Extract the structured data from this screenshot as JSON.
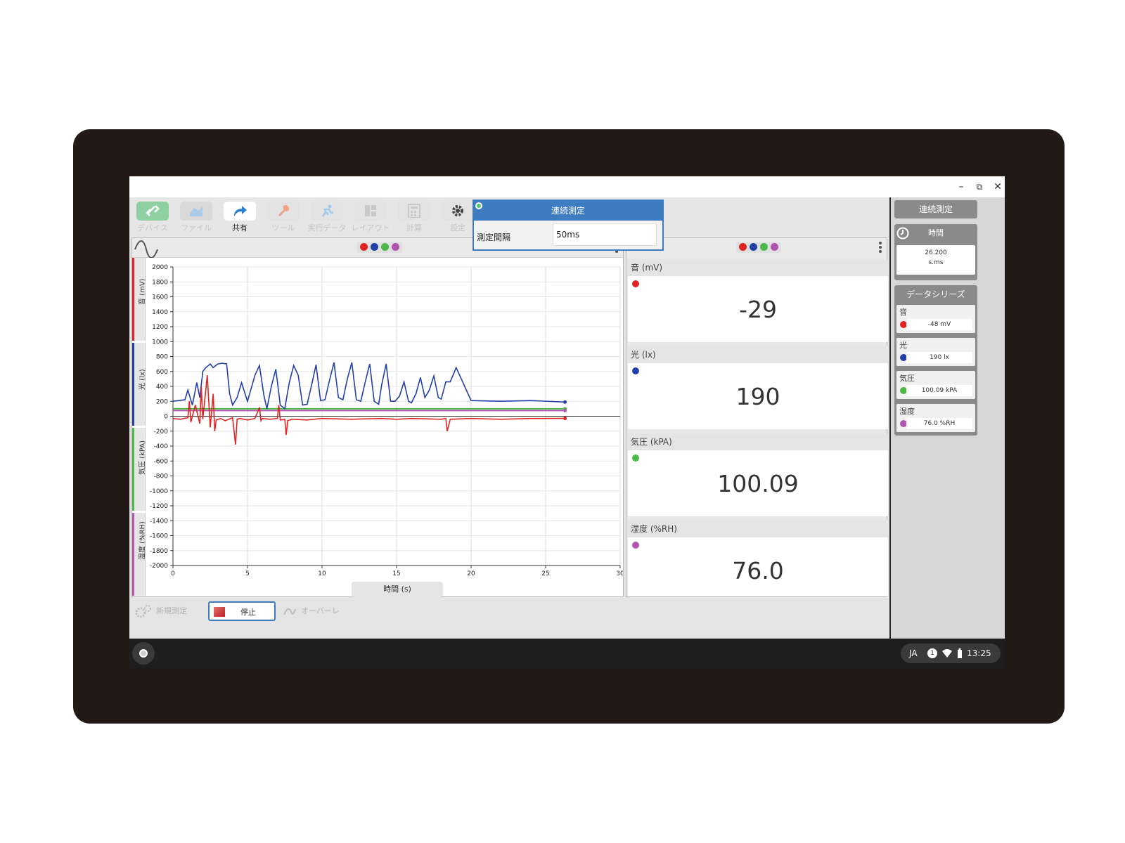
{
  "window": {
    "min": "–",
    "restore": "⧉",
    "close": "✕"
  },
  "toolbar": {
    "items": [
      {
        "label": "デバイス"
      },
      {
        "label": "ファイル"
      },
      {
        "label": "共有"
      },
      {
        "label": "ツール"
      },
      {
        "label": "実行データ"
      },
      {
        "label": "レイアウト"
      },
      {
        "label": "計算"
      },
      {
        "label": "設定"
      }
    ]
  },
  "popup": {
    "title": "連続測定",
    "field_label": "測定間隔",
    "field_value": "50ms"
  },
  "graph": {
    "series_dot_colors": [
      "#e02424",
      "#2340a8",
      "#4cb848",
      "#b055b0"
    ],
    "side_tabs": [
      "音 (mV)",
      "光 (lx)",
      "気圧 (kPA)",
      "湿度 (%RH)"
    ],
    "xaxis_label": "時間 (s)"
  },
  "chart_data": {
    "type": "line",
    "xlabel": "時間 (s)",
    "xlim": [
      0,
      30
    ],
    "ylim": [
      -2000,
      2000
    ],
    "x_ticks": [
      "0",
      "5",
      "10",
      "15",
      "20",
      "25",
      "30"
    ],
    "y_ticks": [
      "2000",
      "1800",
      "1600",
      "1400",
      "1200",
      "1000",
      "800",
      "600",
      "400",
      "200",
      "0",
      "-200",
      "-400",
      "-600",
      "-800",
      "-1000",
      "-1200",
      "-1400",
      "-1600",
      "-1800",
      "-2000"
    ],
    "series": [
      {
        "color": "#2340a8",
        "x": [
          0,
          0.8,
          1.0,
          1.3,
          1.6,
          1.8,
          2.0,
          2.2,
          2.5,
          2.7,
          3.0,
          3.3,
          3.6,
          3.8,
          4.0,
          4.3,
          4.6,
          5.0,
          5.5,
          5.8,
          6.1,
          6.3,
          6.6,
          6.9,
          7.2,
          7.5,
          7.8,
          8.1,
          8.4,
          8.7,
          9.0,
          9.3,
          9.6,
          9.9,
          10.2,
          10.5,
          10.8,
          11.1,
          11.4,
          11.7,
          12.0,
          12.3,
          12.6,
          12.9,
          13.2,
          13.5,
          13.8,
          14.0,
          14.3,
          14.6,
          14.9,
          15.2,
          15.5,
          15.8,
          16.0,
          16.3,
          16.6,
          16.9,
          17.2,
          17.5,
          17.8,
          18.0,
          18.3,
          18.6,
          19.0,
          20,
          22,
          24,
          26.3
        ],
        "y": [
          200,
          220,
          350,
          150,
          450,
          250,
          600,
          650,
          700,
          650,
          700,
          710,
          700,
          300,
          150,
          250,
          450,
          200,
          550,
          680,
          280,
          100,
          400,
          630,
          150,
          100,
          450,
          680,
          550,
          150,
          160,
          420,
          690,
          210,
          220,
          480,
          720,
          250,
          220,
          500,
          720,
          220,
          200,
          460,
          700,
          200,
          160,
          420,
          700,
          200,
          200,
          270,
          460,
          200,
          180,
          300,
          520,
          250,
          350,
          540,
          250,
          230,
          460,
          460,
          650,
          210,
          200,
          210,
          190
        ]
      },
      {
        "color": "#e02424",
        "x": [
          0,
          0.5,
          1.0,
          1.1,
          1.2,
          1.5,
          1.8,
          1.9,
          2.0,
          2.3,
          2.5,
          2.7,
          2.8,
          2.9,
          3.2,
          3.5,
          4.0,
          4.2,
          4.3,
          4.5,
          5.0,
          5.5,
          5.8,
          5.9,
          6.0,
          6.5,
          7.0,
          7.1,
          7.2,
          7.5,
          7.6,
          7.7,
          8.0,
          9.0,
          10.0,
          12.0,
          14.0,
          15.0,
          16.0,
          18.0,
          18.3,
          18.4,
          18.6,
          20.0,
          22.0,
          24.0,
          26.3
        ],
        "y": [
          -30,
          -40,
          -20,
          200,
          -80,
          150,
          -100,
          400,
          -40,
          550,
          -150,
          300,
          -200,
          -50,
          -30,
          -60,
          -20,
          -380,
          -40,
          -30,
          -50,
          -30,
          120,
          -60,
          -30,
          -40,
          -30,
          150,
          -50,
          -40,
          -250,
          -60,
          -40,
          -50,
          -30,
          -40,
          -30,
          -40,
          -30,
          -40,
          -30,
          -200,
          -40,
          -30,
          -40,
          -30,
          -29
        ]
      },
      {
        "color": "#4cb848",
        "x": [
          0,
          26.3
        ],
        "y": [
          100,
          100
        ]
      },
      {
        "color": "#b055b0",
        "x": [
          0,
          26.3
        ],
        "y": [
          76,
          76
        ]
      }
    ]
  },
  "metrics": [
    {
      "title": "音 (mV)",
      "value": "-29",
      "color": "#e02424"
    },
    {
      "title": "光 (lx)",
      "value": "190",
      "color": "#2340a8"
    },
    {
      "title": "気圧 (kPA)",
      "value": "100.09",
      "color": "#4cb848"
    },
    {
      "title": "湿度 (%RH)",
      "value": "76.0",
      "color": "#b055b0"
    }
  ],
  "right": {
    "mode_button": "連続測定",
    "time_label": "時間",
    "time_value": "26.200",
    "time_unit": "s.ms",
    "series_header": "データシリーズ",
    "series": [
      {
        "name": "音",
        "value": "-48 mV",
        "color": "#e02424"
      },
      {
        "name": "光",
        "value": "190 lx",
        "color": "#2340a8"
      },
      {
        "name": "気圧",
        "value": "100.09 kPA",
        "color": "#4cb848"
      },
      {
        "name": "湿度",
        "value": "76.0 %RH",
        "color": "#b055b0"
      }
    ]
  },
  "bottom": {
    "new_label": "新規測定",
    "stop_label": "停止",
    "overlay_label": "オーバーレ"
  },
  "taskbar": {
    "lang": "JA",
    "notif": "1",
    "time": "13:25"
  }
}
